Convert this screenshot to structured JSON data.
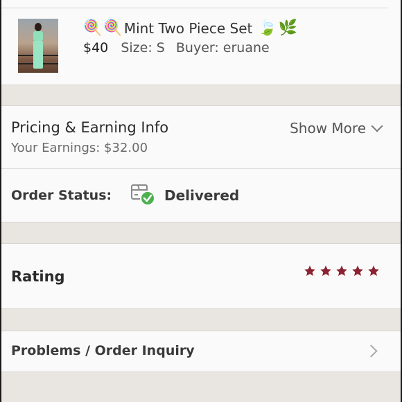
{
  "item": {
    "title": "Mint Two Piece Set",
    "emoji_left": [
      "lollipop",
      "lollipop"
    ],
    "emoji_right": [
      "leaf",
      "herb"
    ],
    "price": "$40",
    "size": "Size: S",
    "buyer": "Buyer: eruane",
    "thumbnail_icon": "product-photo"
  },
  "pricing": {
    "title": "Pricing & Earning Info",
    "earnings": "Your Earnings: $32.00",
    "show_more": "Show More",
    "chevron_icon": "chevron-down-icon"
  },
  "order_status": {
    "label": "Order Status:",
    "value": "Delivered",
    "icon": "package-delivered-icon",
    "accent": "#4caf50"
  },
  "rating": {
    "label": "Rating",
    "stars": 5,
    "star_color": "#8b2232"
  },
  "problems": {
    "label": "Problems / Order Inquiry",
    "chevron_icon": "chevron-right-icon"
  }
}
